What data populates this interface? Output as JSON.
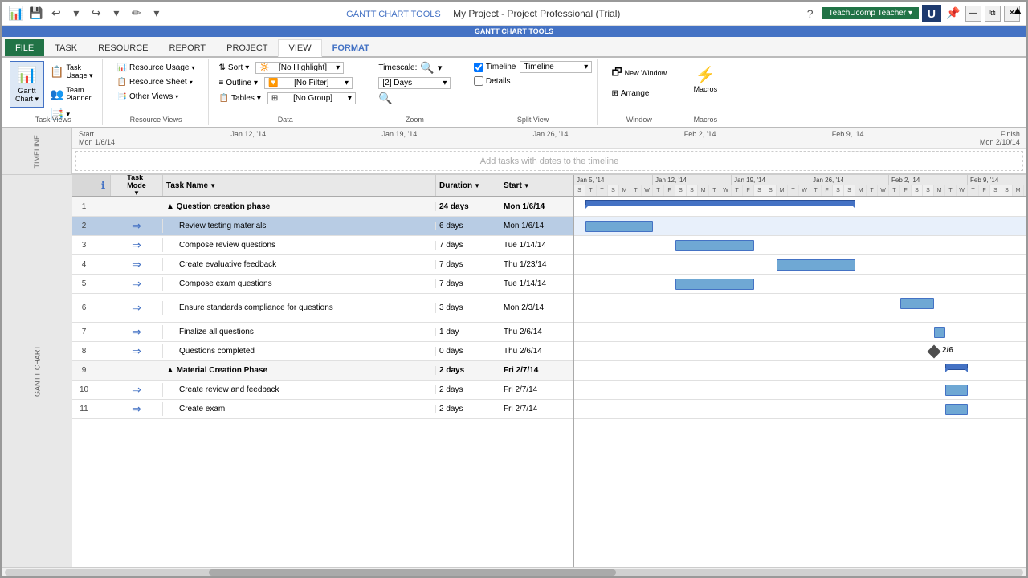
{
  "window": {
    "title": "My Project - Project Professional (Trial)",
    "contextual_band": "GANTT CHART TOOLS",
    "app_icon": "📊"
  },
  "ribbon": {
    "tabs": [
      "FILE",
      "TASK",
      "RESOURCE",
      "REPORT",
      "PROJECT",
      "VIEW",
      "FORMAT"
    ],
    "active_tab": "VIEW",
    "contextual_tab": "FORMAT",
    "groups": {
      "task_views": {
        "label": "Task Views",
        "buttons": [
          "Gantt Chart",
          "Task Usage",
          "Team Planner"
        ]
      },
      "resource_views": {
        "label": "Resource Views",
        "resource_usage": "Resource Usage",
        "resource_sheet": "Resource Sheet",
        "other_views": "Other Views"
      },
      "data": {
        "label": "Data",
        "sort": "Sort",
        "outline": "Outline",
        "tables": "Tables",
        "no_highlight": "[No Highlight]",
        "no_filter": "[No Filter]",
        "no_group": "[No Group]"
      },
      "zoom": {
        "label": "Zoom",
        "timescale": "Timescale:",
        "days": "[2] Days",
        "zoom_in": "🔍"
      },
      "split_view": {
        "label": "Split View",
        "timeline": "Timeline",
        "timeline_name": "Timeline",
        "details": "Details"
      },
      "window": {
        "label": "Window",
        "new_window": "New Window",
        "arrange": "Arrange"
      },
      "macros": {
        "label": "Macros",
        "macros": "Macros"
      }
    }
  },
  "timeline": {
    "label": "TIMELINE",
    "start": "Start",
    "start_date": "Mon 1/6/14",
    "finish": "Finish",
    "finish_date": "Mon 2/10/14",
    "dates": [
      "Jan 12, '14",
      "Jan 19, '14",
      "Jan 26, '14",
      "Feb 2, '14",
      "Feb 9, '14"
    ],
    "placeholder": "Add tasks with dates to the timeline"
  },
  "columns": {
    "mode": "Task\nMode",
    "name": "Task Name",
    "duration": "Duration",
    "start": "Start"
  },
  "tasks": [
    {
      "id": 1,
      "indent": 0,
      "summary": true,
      "name": "▲ Question creation phase",
      "duration": "24 days",
      "start": "Mon 1/6/14",
      "bold": true
    },
    {
      "id": 2,
      "indent": 1,
      "summary": false,
      "name": "Review testing materials",
      "duration": "6 days",
      "start": "Mon 1/6/14",
      "bold": false,
      "selected": true
    },
    {
      "id": 3,
      "indent": 1,
      "summary": false,
      "name": "Compose review questions",
      "duration": "7 days",
      "start": "Tue 1/14/14",
      "bold": false
    },
    {
      "id": 4,
      "indent": 1,
      "summary": false,
      "name": "Create evaluative feedback",
      "duration": "7 days",
      "start": "Thu 1/23/14",
      "bold": false
    },
    {
      "id": 5,
      "indent": 1,
      "summary": false,
      "name": "Compose exam questions",
      "duration": "7 days",
      "start": "Tue 1/14/14",
      "bold": false
    },
    {
      "id": 6,
      "indent": 1,
      "summary": false,
      "name": "Ensure standards compliance for questions",
      "duration": "3 days",
      "start": "Mon 2/3/14",
      "bold": false
    },
    {
      "id": 7,
      "indent": 1,
      "summary": false,
      "name": "Finalize all questions",
      "duration": "1 day",
      "start": "Thu 2/6/14",
      "bold": false
    },
    {
      "id": 8,
      "indent": 1,
      "summary": false,
      "name": "Questions completed",
      "duration": "0 days",
      "start": "Thu 2/6/14",
      "bold": false,
      "milestone": true,
      "milestone_label": "2/6"
    },
    {
      "id": 9,
      "indent": 0,
      "summary": true,
      "name": "▲ Material Creation Phase",
      "duration": "2 days",
      "start": "Fri 2/7/14",
      "bold": true
    },
    {
      "id": 10,
      "indent": 1,
      "summary": false,
      "name": "Create review and feedback",
      "duration": "2 days",
      "start": "Fri 2/7/14",
      "bold": false
    },
    {
      "id": 11,
      "indent": 1,
      "summary": false,
      "name": "Create exam",
      "duration": "2 days",
      "start": "Fri 2/7/14",
      "bold": false
    }
  ],
  "gantt": {
    "date_headers_top": [
      "Jan 5, '14",
      "Jan 12, '14",
      "Jan 19, '14",
      "Jan 26, '14",
      "Feb 2, '14",
      "Feb 9, '14"
    ],
    "day_headers": [
      "S",
      "T",
      "T",
      "S",
      "M",
      "W",
      "F",
      "S",
      "M",
      "W",
      "F",
      "S",
      "M",
      "W",
      "F",
      "S",
      "M",
      "W",
      "F",
      "S",
      "M",
      "W",
      "F",
      "S",
      "M",
      "W",
      "F",
      "S",
      "M",
      "W",
      "F",
      "S",
      "M",
      "W",
      "F",
      "S",
      "M",
      "W",
      "F",
      "S"
    ]
  },
  "user": "TeachUcomp Teacher",
  "title_bar": {
    "help": "?",
    "minimize": "—",
    "restore": "⧉",
    "close": "✕"
  }
}
